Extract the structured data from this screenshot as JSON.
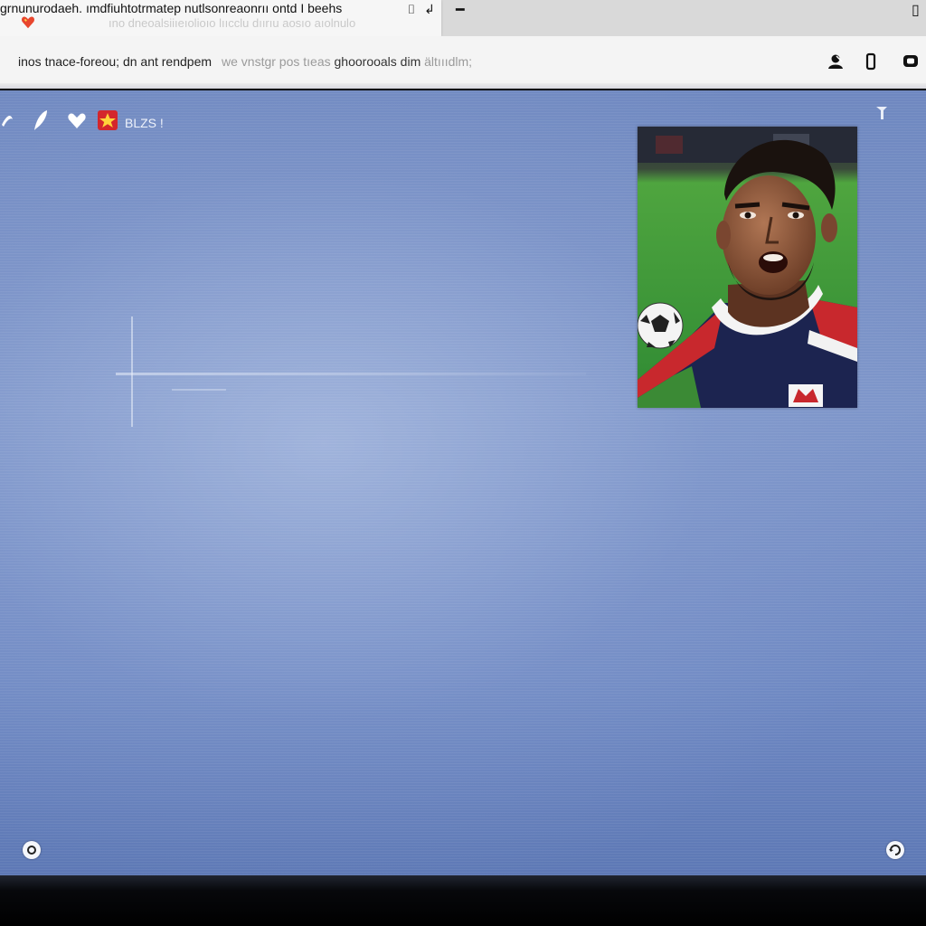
{
  "browser": {
    "tab": {
      "title": "grnunurodaeh. ımdfiuhtotrmatep nutlsonreaonrıı ontd I beehs",
      "subtitle": "ıno dneoalsiiıeıolioıo lııcclu dıırıu aosıo aıolnulo",
      "favicon": "heart-icon"
    },
    "window_controls": {
      "tab_close": "⌷",
      "tab_extra": "↲",
      "minimize": "━",
      "maximize": "▯"
    },
    "address": {
      "url": "inos tnace-foreou; dn ant rendpem",
      "url_faded_prefix": "we vnstgr pos tıeas",
      "url_faded_mid": "ghoorooals dim",
      "url_faded_suffix": "ältıııdlm;"
    },
    "toolbar_icons": [
      "profile-icon",
      "phone-icon",
      "chat-icon"
    ]
  },
  "page": {
    "nav": {
      "label": "BLZS !"
    },
    "photo": {
      "alt": "soccer-player-photo"
    }
  },
  "colors": {
    "content_bg": "#7890c6",
    "tab_bg": "#f6f6f6",
    "titlebar_bg": "#d9d9d9",
    "jersey_red": "#c8282d",
    "jersey_navy": "#1c2450",
    "pitch_green": "#3a9a3a"
  }
}
